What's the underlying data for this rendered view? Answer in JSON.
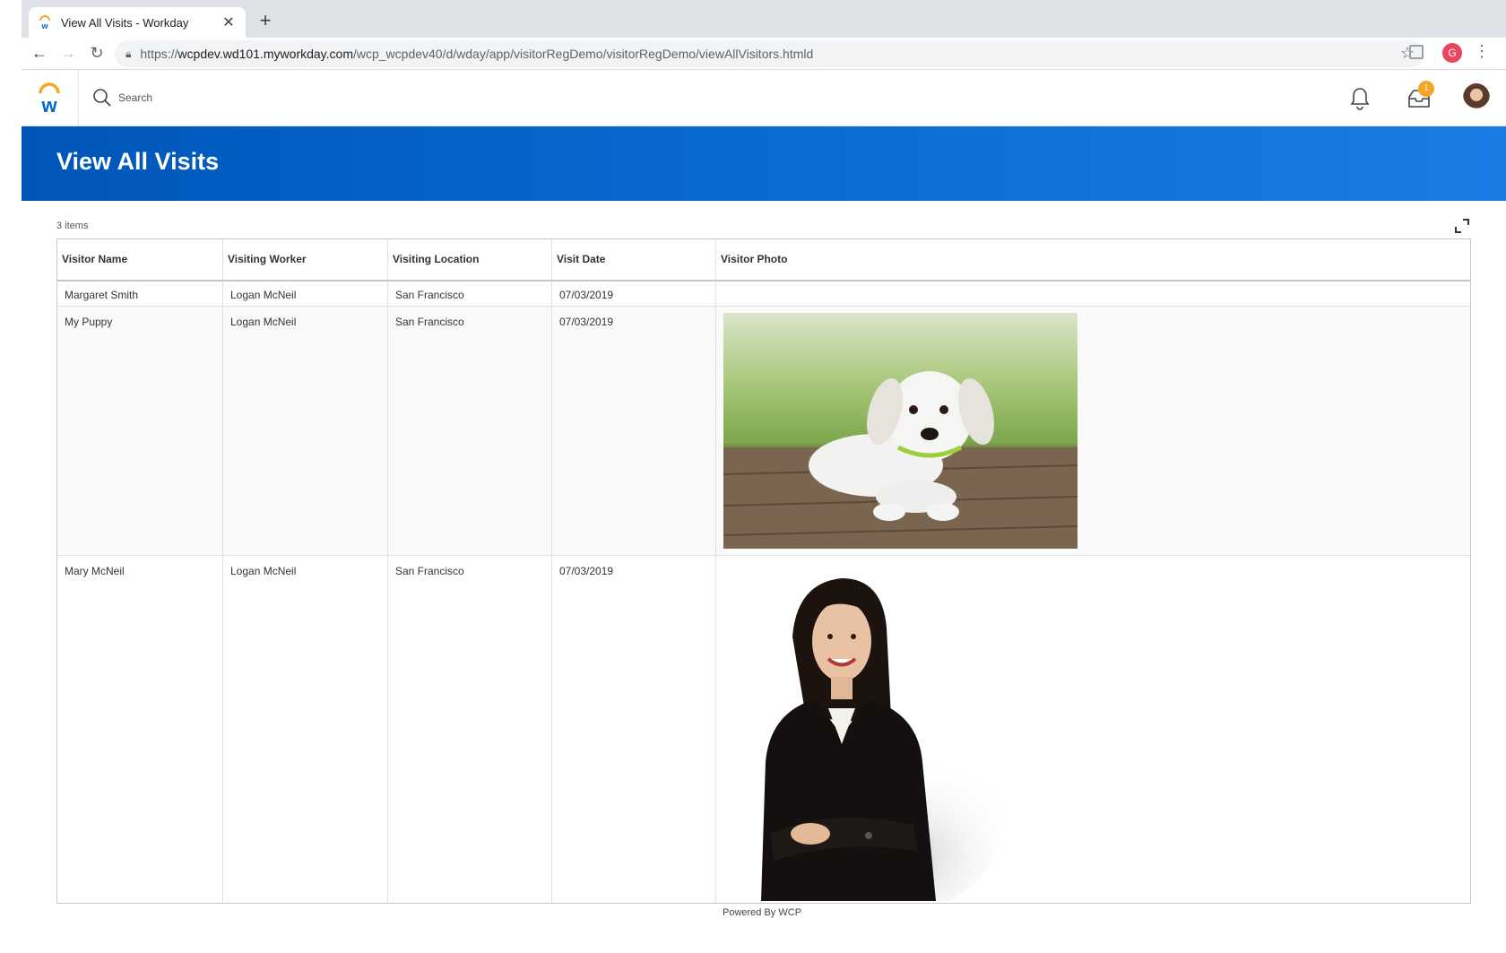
{
  "browser": {
    "tab_title": "View All Visits - Workday",
    "url_prefix": "https://",
    "url_host": "wcpdev.wd101.myworkday.com",
    "url_path": "/wcp_wcpdev40/d/wday/app/visitorRegDemo/visitorRegDemo/viewAllVisitors.htmld",
    "profile_initial": "G"
  },
  "header": {
    "search_placeholder": "Search",
    "inbox_badge": "1"
  },
  "page": {
    "title": "View All Visits",
    "items_count": "3 items",
    "footer": "Powered By WCP"
  },
  "table": {
    "columns": [
      "Visitor Name",
      "Visiting Worker",
      "Visiting Location",
      "Visit Date",
      "Visitor Photo"
    ],
    "rows": [
      {
        "visitor_name": "Margaret Smith",
        "visiting_worker": "Logan McNeil",
        "visiting_location": "San Francisco",
        "visit_date": "07/03/2019",
        "photo": "none"
      },
      {
        "visitor_name": "My Puppy",
        "visiting_worker": "Logan McNeil",
        "visiting_location": "San Francisco",
        "visit_date": "07/03/2019",
        "photo": "puppy-photo"
      },
      {
        "visitor_name": "Mary McNeil",
        "visiting_worker": "Logan McNeil",
        "visiting_location": "San Francisco",
        "visit_date": "07/03/2019",
        "photo": "woman-photo"
      }
    ]
  },
  "colors": {
    "banner_start": "#0056b8",
    "banner_end": "#1a7de6",
    "badge": "#f5a623",
    "workday_orange": "#f5a623",
    "workday_blue": "#0067c5"
  }
}
